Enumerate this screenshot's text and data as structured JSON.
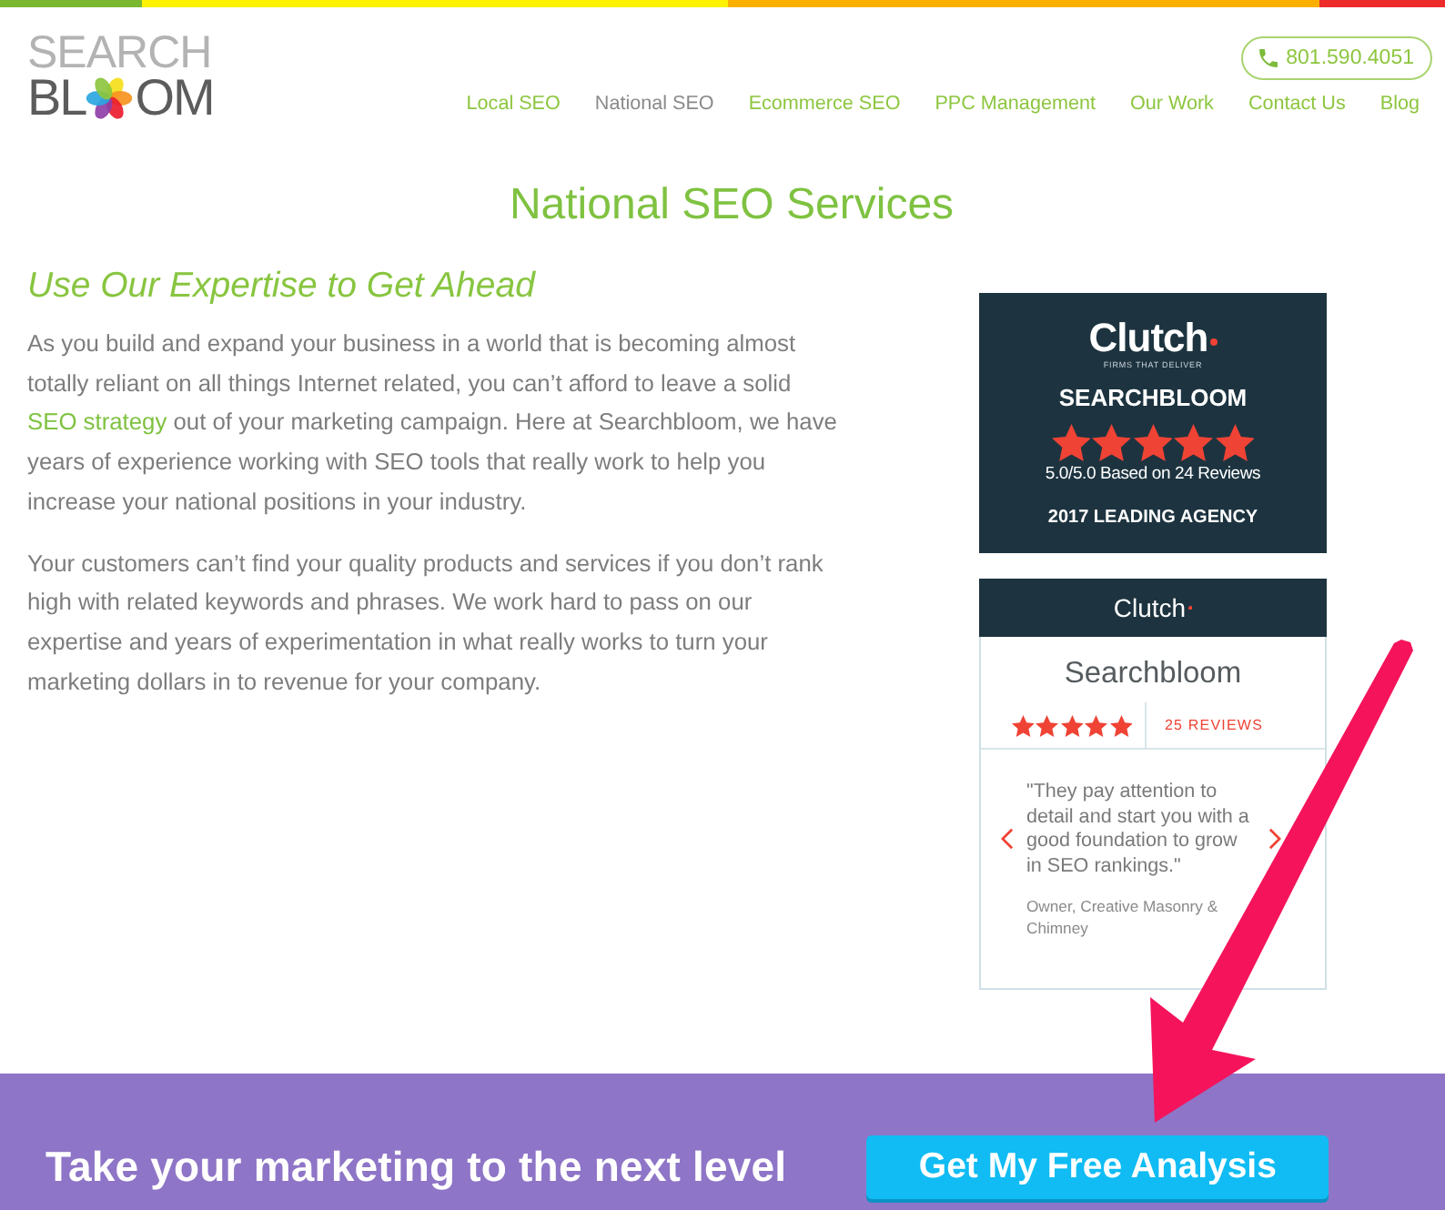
{
  "header": {
    "logo": {
      "top_line": "SEARCH",
      "bottom_start": "BL",
      "bottom_end": "OM"
    },
    "phone": "801.590.4051",
    "nav": [
      {
        "label": "Local SEO",
        "selected": false
      },
      {
        "label": "National SEO",
        "selected": true
      },
      {
        "label": "Ecommerce SEO",
        "selected": false
      },
      {
        "label": "PPC Management",
        "selected": false
      },
      {
        "label": "Our Work",
        "selected": false
      },
      {
        "label": "Contact Us",
        "selected": false
      },
      {
        "label": "Blog",
        "selected": false
      }
    ]
  },
  "page_title": "National SEO Services",
  "intro": {
    "heading": "Use Our Expertise to Get Ahead",
    "paragraphs": [
      [
        {
          "kind": "text",
          "text": "As you build and expand your business in a world that is becoming almost totally reliant on all things Internet related, you can’t afford to leave a solid "
        },
        {
          "kind": "link",
          "text": "SEO strategy"
        },
        {
          "kind": "text",
          "text": " out of your marketing campaign. Here at Searchbloom, we have years of experience working with SEO tools that really work to help you increase your national positions in your industry."
        }
      ],
      [
        {
          "kind": "text",
          "text": "Your customers can’t find your quality products and services if you don’t rank high with related keywords and phrases. We work hard to pass on our expertise and years of experimentation in what really works to turn your marketing dollars in to revenue for your company."
        }
      ]
    ]
  },
  "clutch_badge": {
    "logo": "Clutch",
    "tagline": "FIRMS THAT DELIVER",
    "company": "SEARCHBLOOM",
    "stars": 5,
    "rating": "5.0/5.0 Based on 24 Reviews",
    "award": "2017 LEADING AGENCY"
  },
  "review_widget": {
    "header": "Clutch",
    "company": "Searchbloom",
    "stars": 5,
    "reviews_link": "25 REVIEWS",
    "quote": "\"They pay attention to detail and start you with a good foundation to grow in SEO rankings.\"",
    "author": "Owner, Creative Masonry & Chimney"
  },
  "banner": {
    "text": "Take your marketing to the next level",
    "button": "Get My Free Analysis"
  }
}
